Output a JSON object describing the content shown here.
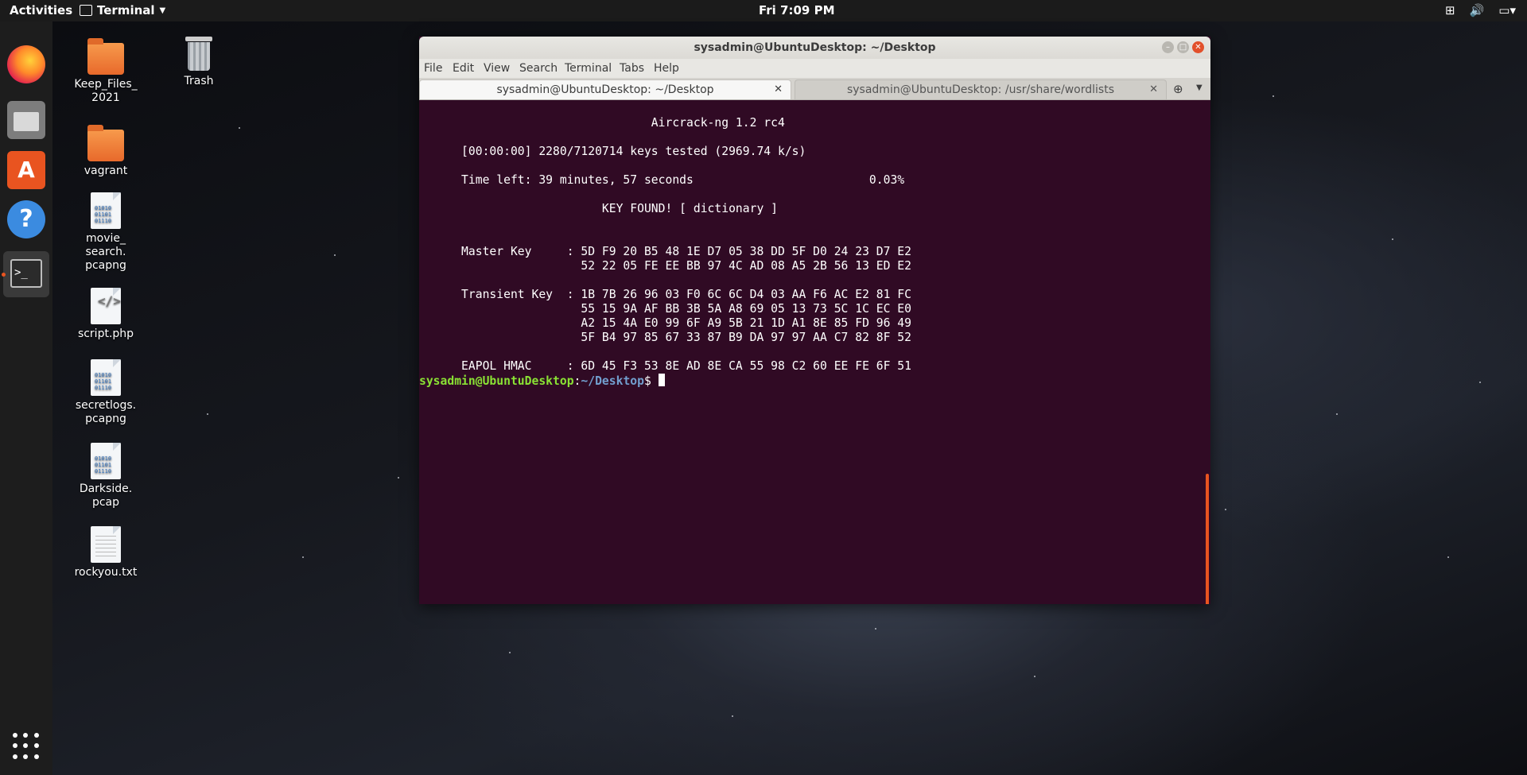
{
  "topbar": {
    "activities": "Activities",
    "app_name": "Terminal",
    "clock": "Fri  7:09 PM",
    "tray_icons": [
      "network-icon",
      "volume-icon",
      "battery-icon"
    ]
  },
  "dock": {
    "items": [
      "firefox-icon",
      "files-icon",
      "software-icon",
      "help-icon",
      "terminal-icon",
      "show-apps-icon"
    ]
  },
  "desktop": {
    "icons": [
      {
        "label": "Keep_Files_\n2021",
        "type": "folder"
      },
      {
        "label": "Trash",
        "type": "trash"
      },
      {
        "label": "vagrant",
        "type": "folder"
      },
      {
        "label": "movie_\nsearch.\npcapng",
        "type": "binary"
      },
      {
        "label": "script.php",
        "type": "code"
      },
      {
        "label": "secretlogs.\npcapng",
        "type": "binary"
      },
      {
        "label": "Darkside.\npcap",
        "type": "binary"
      },
      {
        "label": "rockyou.txt",
        "type": "text"
      }
    ]
  },
  "window": {
    "title": "sysadmin@UbuntuDesktop: ~/Desktop",
    "menu": [
      "File",
      "Edit",
      "View",
      "Search",
      "Terminal",
      "Tabs",
      "Help"
    ],
    "tabs": [
      {
        "label": "sysadmin@UbuntuDesktop: ~/Desktop",
        "active": true
      },
      {
        "label": "sysadmin@UbuntuDesktop: /usr/share/wordlists",
        "active": false
      }
    ]
  },
  "terminal": {
    "lines": [
      "                                 Aircrack-ng 1.2 rc4",
      "",
      "      [00:00:00] 2280/7120714 keys tested (2969.74 k/s)",
      "",
      "      Time left: 39 minutes, 57 seconds                         0.03%",
      "",
      "                          KEY FOUND! [ dictionary ]",
      "",
      "",
      "      Master Key     : 5D F9 20 B5 48 1E D7 05 38 DD 5F D0 24 23 D7 E2",
      "                       52 22 05 FE EE BB 97 4C AD 08 A5 2B 56 13 ED E2",
      "",
      "      Transient Key  : 1B 7B 26 96 03 F0 6C 6C D4 03 AA F6 AC E2 81 FC",
      "                       55 15 9A AF BB 3B 5A A8 69 05 13 73 5C 1C EC E0",
      "                       A2 15 4A E0 99 6F A9 5B 21 1D A1 8E 85 FD 96 49",
      "                       5F B4 97 85 67 33 87 B9 DA 97 97 AA C7 82 8F 52",
      "",
      "      EAPOL HMAC     : 6D 45 F3 53 8E AD 8E CA 55 98 C2 60 EE FE 6F 51"
    ],
    "prompt_user": "sysadmin@UbuntuDesktop",
    "prompt_sep": ":",
    "prompt_path": "~/Desktop",
    "prompt_symbol": "$ "
  },
  "colors": {
    "terminal_bg": "#300a24",
    "prompt_user": "#8ae234",
    "prompt_path": "#729fcf",
    "accent": "#e95420"
  }
}
